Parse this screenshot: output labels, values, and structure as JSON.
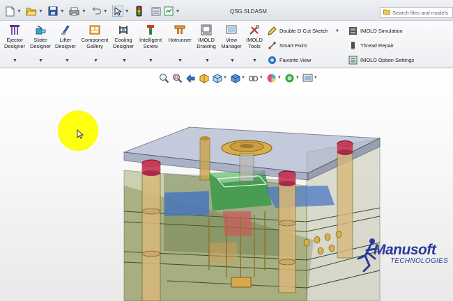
{
  "title_bar": {
    "document_title": "QSG.SLDASM",
    "search_placeholder": "Search files and models",
    "quick_access": [
      "new-icon",
      "open-icon",
      "save-icon",
      "print-icon",
      "undo-icon",
      "select-icon",
      "traffic-light-icon",
      "file-properties-icon",
      "options-icon"
    ]
  },
  "ribbon": {
    "large_buttons": [
      {
        "label_line1": "Ejector",
        "label_line2": "Designer",
        "icon": "ejector-icon"
      },
      {
        "label_line1": "Slider",
        "label_line2": "Designer",
        "icon": "slider-icon"
      },
      {
        "label_line1": "Lifter",
        "label_line2": "Designer",
        "icon": "lifter-icon"
      },
      {
        "label_line1": "Component",
        "label_line2": "Gallery",
        "icon": "gallery-icon"
      },
      {
        "label_line1": "Cooling",
        "label_line2": "Designer",
        "icon": "cooling-icon"
      },
      {
        "label_line1": "Intelligent",
        "label_line2": "Screw",
        "icon": "screw-icon"
      },
      {
        "label_line1": "Hotrunner",
        "label_line2": "",
        "icon": "hotrunner-icon"
      },
      {
        "label_line1": "IMOLD",
        "label_line2": "Drawing",
        "icon": "drawing-icon"
      },
      {
        "label_line1": "View",
        "label_line2": "Manager",
        "icon": "view-manager-icon"
      },
      {
        "label_line1": "IMOLD",
        "label_line2": "Tools",
        "icon": "tools-icon"
      }
    ],
    "small_items": [
      {
        "label": "Double D Cut Sketch",
        "icon": "sketch-icon"
      },
      {
        "label": "Smart Point",
        "icon": "smart-point-icon"
      },
      {
        "label": "Favorite View",
        "icon": "favorite-view-icon"
      },
      {
        "label": "IMOLD Simulation",
        "icon": "simulation-icon"
      },
      {
        "label": "Thread Repair",
        "icon": "thread-repair-icon"
      },
      {
        "label": "IMOLD Option Settings",
        "icon": "option-settings-icon"
      }
    ]
  },
  "view_toolbar": [
    "zoom-to-fit-icon",
    "zoom-area-icon",
    "previous-view-icon",
    "section-view-icon",
    "view-orientation-icon",
    "display-style-icon",
    "hide-show-icon",
    "appearance-icon",
    "scene-icon",
    "display-settings-icon"
  ],
  "logo": {
    "name": "Manusoft",
    "tagline": "TECHNOLOGIES"
  }
}
